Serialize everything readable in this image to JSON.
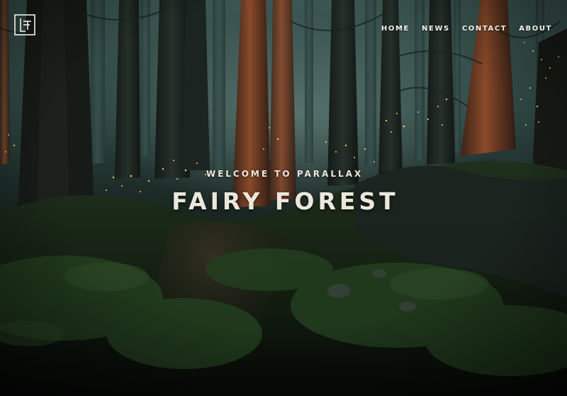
{
  "logo": {
    "icon": "monogram-logo-icon",
    "color": "#f1efe9"
  },
  "nav": {
    "items": [
      {
        "label": "HOME"
      },
      {
        "label": "NEWS"
      },
      {
        "label": "CONTACT"
      },
      {
        "label": "ABOUT"
      }
    ]
  },
  "hero": {
    "kicker": "WELCOME TO PARALLAX",
    "title": "FAIRY FOREST"
  },
  "background": {
    "scene": "forest-background",
    "colors": {
      "mist": "#3c5753",
      "ground": "#0b110e",
      "moss": "#1f3a1c",
      "trunk": "#1a1512",
      "redwood": "#6b3a22",
      "firefly": "#f6c25a"
    }
  }
}
